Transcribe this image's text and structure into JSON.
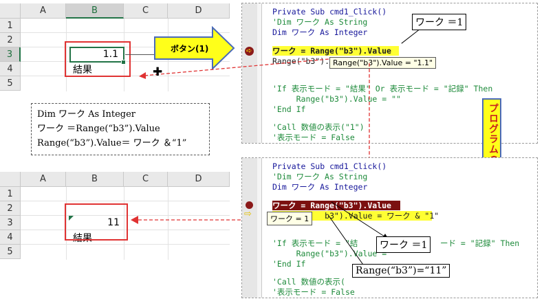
{
  "top_sheet": {
    "columns": [
      "A",
      "B",
      "C",
      "D"
    ],
    "rows": [
      "1",
      "2",
      "3",
      "4",
      "5"
    ],
    "b3_value": "1.1",
    "b4_value": "結果"
  },
  "bottom_sheet": {
    "columns": [
      "A",
      "B",
      "C",
      "D"
    ],
    "rows": [
      "1",
      "2",
      "3",
      "4",
      "5"
    ],
    "b3_value": "11",
    "b4_value": "結果"
  },
  "button_arrow": {
    "label": "ボタン(1)"
  },
  "program_arrow": {
    "label": "プログラムの実行"
  },
  "top_editor": {
    "lines": [
      "Private Sub cmd1_Click()",
      "'Dim ワーク As String",
      "Dim ワーク As Integer",
      "",
      "ワーク = Range(\"b3\").Value",
      "Range(\"b3\").",
      "",
      "",
      "'If 表示モード = \"結果\" Or 表示モード = \"記録\" Then",
      "     Range(\"b3\").Value = \"\"",
      "'End If",
      "",
      "'Call 数値の表示(\"1\")",
      "'表示モード = False"
    ],
    "tooltip": "Range(\"b3\").Value = \"1.1\"",
    "callout": "ワーク ＝1"
  },
  "bottom_editor": {
    "lines": [
      "Private Sub cmd1_Click()",
      "'Dim ワーク As String",
      "Dim ワーク As Integer",
      "",
      "ワーク = Range(\"b3\").Value",
      "           b3\").Value = ワーク & \"1\"",
      "",
      "",
      "'If 表示モード = \"結",
      "     Range(\"b3\").Value = \"",
      "'End If",
      "",
      "'Call 数値の表示(",
      "'表示モード = False"
    ],
    "if_suffix": "ード = \"記録\" Then",
    "tooltip": "ワーク = 1",
    "callout_work": "ワーク ＝1",
    "callout_range": "Range(“b3”)=“11”"
  },
  "note": {
    "line1": "Dim  ワーク  As Integer",
    "line2": "ワーク  ＝Range(“b3”).Value",
    "line3": "Range(“b3”).Value＝  ワーク  ＆“1”"
  },
  "colors": {
    "excel_green": "#217346",
    "highlight_yellow": "#ffff33",
    "breakpoint_red": "#7b1010",
    "arrow_red": "#e03232"
  }
}
